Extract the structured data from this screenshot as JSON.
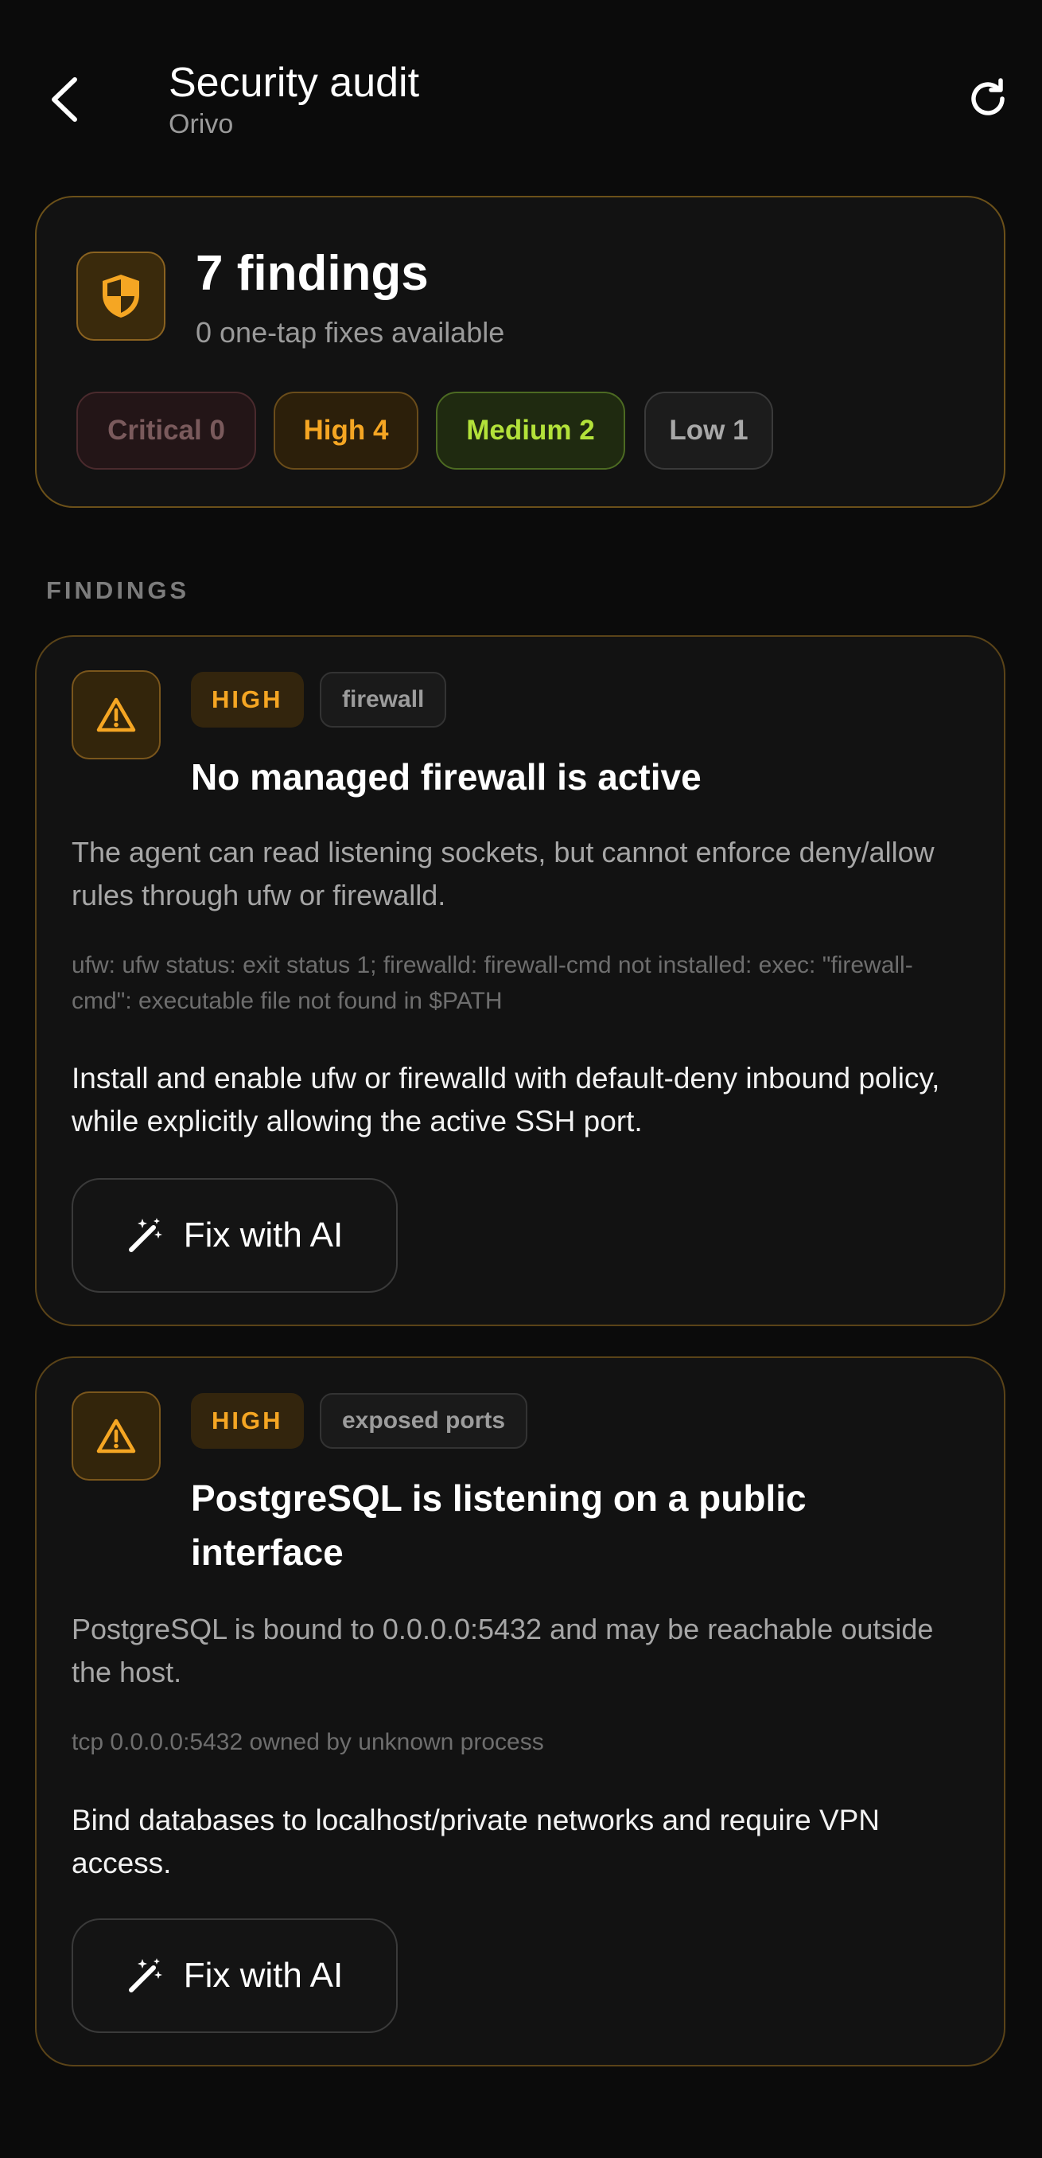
{
  "header": {
    "title": "Security audit",
    "subtitle": "Orivo",
    "back_icon": "chevron-left-icon",
    "refresh_icon": "refresh-icon"
  },
  "summary": {
    "count_label": "7 findings",
    "fixes_label": "0 one-tap fixes available",
    "icon": "shield-icon",
    "chips": {
      "critical": "Critical 0",
      "high": "High 4",
      "medium": "Medium 2",
      "low": "Low 1"
    }
  },
  "section": {
    "label": "FINDINGS"
  },
  "findings": [
    {
      "severity": "HIGH",
      "category": "firewall",
      "title": "No managed firewall is active",
      "description": "The agent can read listening sockets, but cannot enforce deny/allow rules through ufw or firewalld.",
      "evidence": "ufw: ufw status: exit status 1; firewalld: firewall-cmd not installed: exec: \"firewall-cmd\": executable file not found in $PATH",
      "recommendation": "Install and enable ufw or firewalld with default-deny inbound policy, while explicitly allowing the active SSH port.",
      "action_label": "Fix with AI"
    },
    {
      "severity": "HIGH",
      "category": "exposed ports",
      "title": "PostgreSQL is listening on a public interface",
      "description": "PostgreSQL is bound to 0.0.0.0:5432 and may be reachable outside the host.",
      "evidence": "tcp 0.0.0.0:5432 owned by unknown process",
      "recommendation": "Bind databases to localhost/private networks and require VPN access.",
      "action_label": "Fix with AI"
    }
  ],
  "colors": {
    "background": "#0b0b0b",
    "card": "#121212",
    "accent_high": "#f5a623",
    "accent_medium": "#b3e23a",
    "critical_muted": "#7a5a5c",
    "low_muted": "#a8a8a8"
  }
}
